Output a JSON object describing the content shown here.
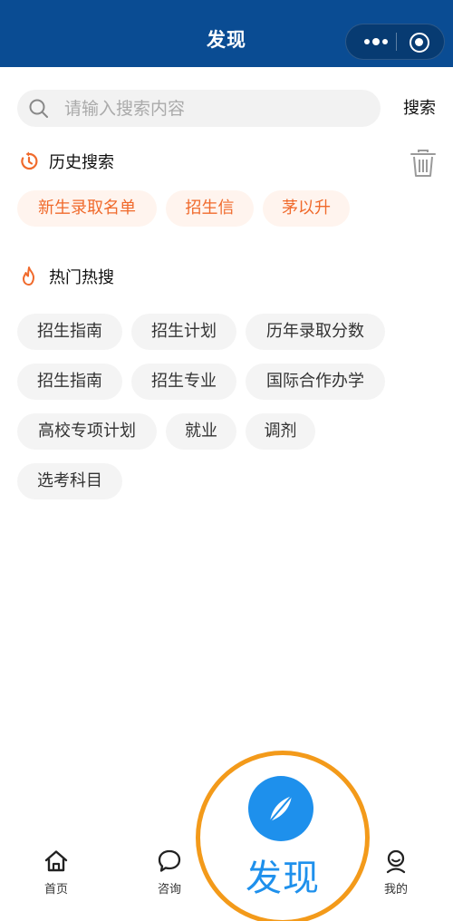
{
  "header": {
    "title": "发现"
  },
  "search": {
    "placeholder": "请输入搜索内容",
    "button_label": "搜索"
  },
  "history": {
    "title": "历史搜索",
    "tags": [
      "新生录取名单",
      "招生信",
      "茅以升"
    ]
  },
  "hot": {
    "title": "热门热搜",
    "tags": [
      "招生指南",
      "招生计划",
      "历年录取分数",
      "招生指南",
      "招生专业",
      "国际合作办学",
      "高校专项计划",
      "就业",
      "调剂",
      "选考科目"
    ]
  },
  "tabbar": {
    "items": [
      {
        "label": "首页",
        "icon": "home-icon"
      },
      {
        "label": "咨询",
        "icon": "chat-icon"
      },
      {
        "label": "发现",
        "icon": "compass-icon"
      },
      {
        "label": "我的",
        "icon": "user-icon"
      }
    ]
  },
  "colors": {
    "header_bg": "#0a4c93",
    "accent_orange": "#f06a2c",
    "accent_blue": "#1e90ec",
    "highlight_ring": "#f39a1a"
  }
}
